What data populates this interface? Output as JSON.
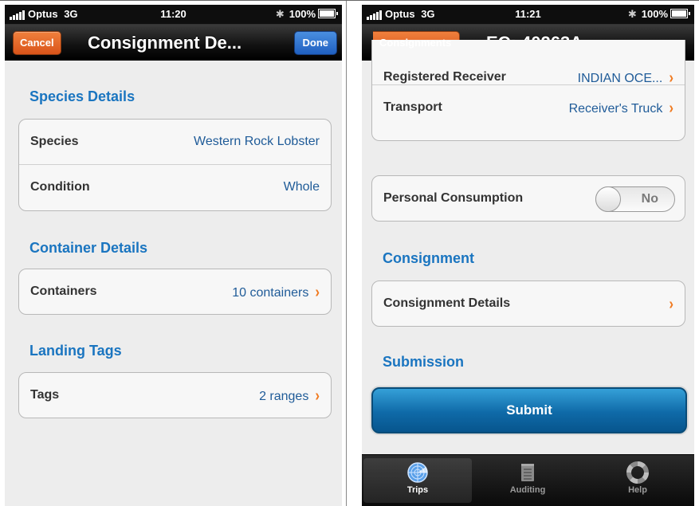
{
  "left": {
    "status": {
      "carrier": "Optus",
      "network": "3G",
      "time": "11:20",
      "battery": "100%"
    },
    "nav": {
      "cancel": "Cancel",
      "title": "Consignment De...",
      "done": "Done"
    },
    "sections": {
      "species": {
        "heading": "Species Details",
        "rows": [
          {
            "label": "Species",
            "value": "Western Rock Lobster"
          },
          {
            "label": "Condition",
            "value": "Whole"
          }
        ]
      },
      "container": {
        "heading": "Container Details",
        "rows": [
          {
            "label": "Containers",
            "value": "10 containers"
          }
        ]
      },
      "landing": {
        "heading": "Landing Tags",
        "rows": [
          {
            "label": "Tags",
            "value": "2 ranges"
          }
        ]
      }
    }
  },
  "right": {
    "status": {
      "carrier": "Optus",
      "network": "3G",
      "time": "11:21",
      "battery": "100%"
    },
    "nav": {
      "back": "Consignments",
      "title": "EC: 40263A"
    },
    "partial_row": {
      "label": "Registered Receiver",
      "value": "INDIAN OCE..."
    },
    "transport": {
      "label": "Transport",
      "value": "Receiver's Truck"
    },
    "personal": {
      "label": "Personal Consumption",
      "toggle": "No"
    },
    "consignment": {
      "heading": "Consignment",
      "row": "Consignment Details"
    },
    "submission": {
      "heading": "Submission",
      "button": "Submit"
    },
    "tabs": [
      {
        "label": "Trips",
        "icon": "radar-icon",
        "active": true
      },
      {
        "label": "Auditing",
        "icon": "notepad-icon",
        "active": false
      },
      {
        "label": "Help",
        "icon": "lifebuoy-icon",
        "active": false
      }
    ]
  },
  "colors": {
    "accent_orange": "#e0602a",
    "accent_blue_button": "#2a6fd0",
    "section_heading": "#1a75c0",
    "value_text": "#1f5b98",
    "submit_blue": "#0f6aa8"
  }
}
